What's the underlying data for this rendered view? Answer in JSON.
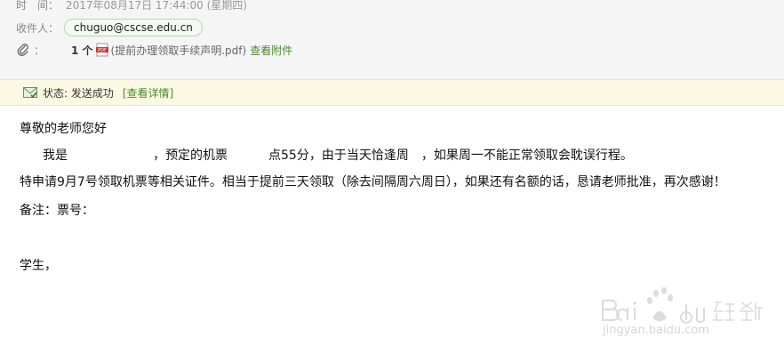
{
  "header": {
    "time_label": "时　间：",
    "time_value": "2017年08月17日 17:44:00 (星期四)",
    "recipient_label": "收件人：",
    "recipient": "chuguo@cscse.edu.cn",
    "attachment_label": "：",
    "attachment_count": "1 个",
    "attachment_name": "(提前办理领取手续声明.pdf)",
    "attachment_link": "查看附件"
  },
  "status": {
    "text": "状态: 发送成功",
    "link": "[查看详情]"
  },
  "body": {
    "greeting": "尊敬的老师您好",
    "line2_a": "我是",
    "line2_b": "，预定的机票",
    "line2_c": "点55分，由于当天恰逢周　，如果周一不能正常领取会耽误行程。",
    "line3": "特申请9月7号领取机票等相关证件。相当于提前三天领取（除去间隔周六周日），如果还有名额的话，恳请老师批准，再次感谢！",
    "line4": "备注：票号：",
    "signature": "学生，"
  },
  "watermark": {
    "text": "jingyan.baidu.com"
  }
}
